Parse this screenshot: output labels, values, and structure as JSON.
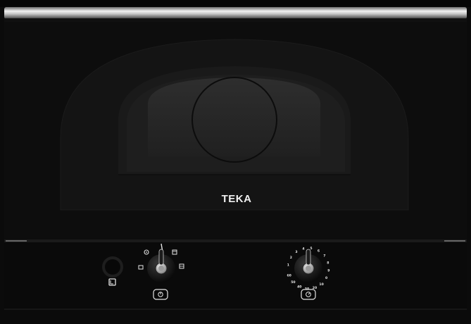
{
  "appliance": {
    "brand": "TEKA",
    "body_color": "#0b0b0b",
    "trim_color": "#d9d9d9"
  },
  "controls": {
    "function_knob": {
      "icons": [
        "fan-icon",
        "grill-icon",
        "top-heat-icon",
        "combi-icon"
      ]
    },
    "timer_knob": {
      "scale": [
        "1",
        "2",
        "3",
        "4",
        "5",
        "6",
        "7",
        "8",
        "9",
        "0",
        "10",
        "20",
        "30",
        "40",
        "50",
        "60"
      ]
    }
  }
}
